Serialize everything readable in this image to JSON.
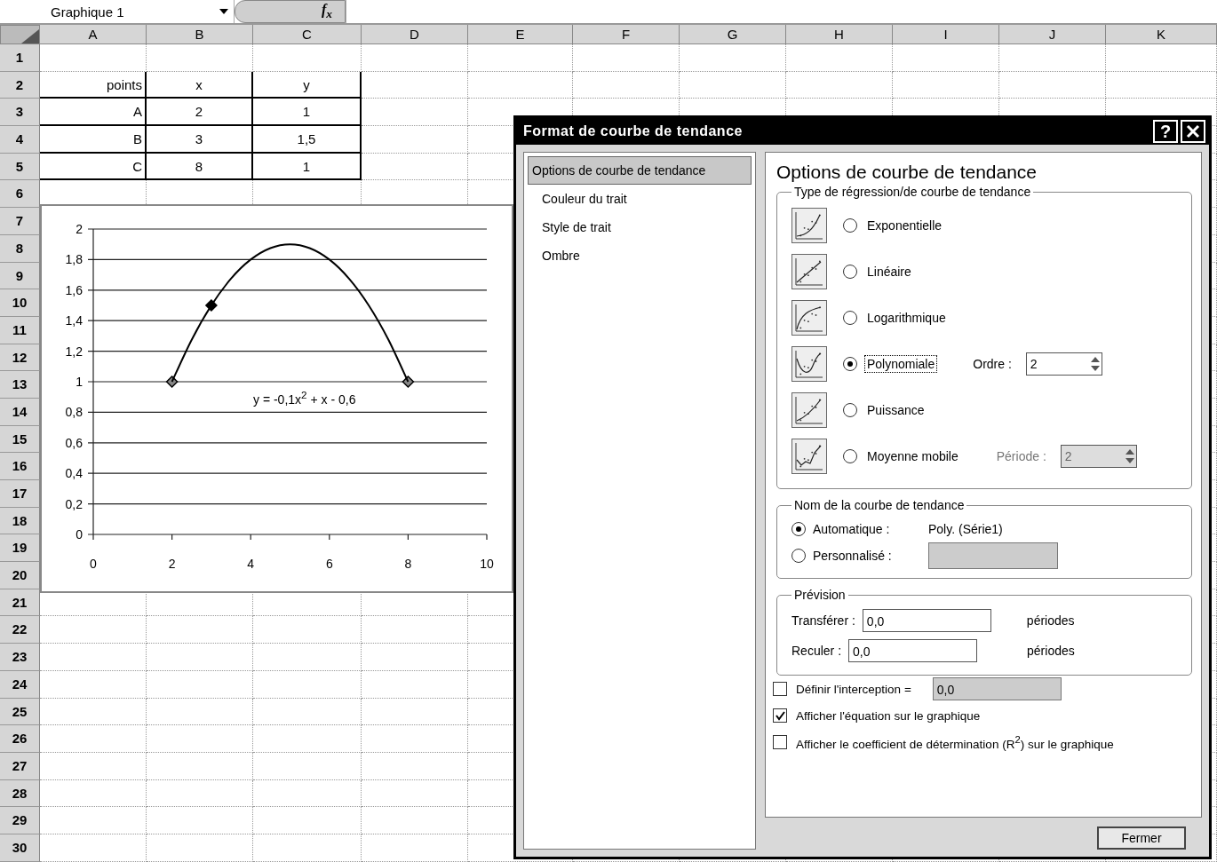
{
  "formula_bar": {
    "name_box": "Graphique 1",
    "function_button": "f$_{x}$"
  },
  "sheet": {
    "columns": [
      "A",
      "B",
      "C",
      "D",
      "E",
      "F",
      "G",
      "H",
      "I",
      "J",
      "K"
    ],
    "rows": [
      "1",
      "2",
      "3",
      "4",
      "5",
      "6",
      "7",
      "8",
      "9",
      "10",
      "11",
      "12",
      "13",
      "14",
      "15",
      "16",
      "17",
      "18",
      "19",
      "20",
      "21",
      "22",
      "23",
      "24",
      "25",
      "26",
      "27",
      "28",
      "29",
      "30"
    ],
    "table": {
      "rows": [
        [
          "points",
          "x",
          "y"
        ],
        [
          "A",
          "2",
          "1"
        ],
        [
          "B",
          "3",
          "1,5"
        ],
        [
          "C",
          "8",
          "1"
        ]
      ]
    }
  },
  "chart": {
    "chart_data": {
      "type": "scatter",
      "xlim": [
        0,
        10
      ],
      "ylim": [
        0,
        2
      ],
      "xticks": [
        0,
        2,
        4,
        6,
        8,
        10
      ],
      "yticks": [
        {
          "value": 0,
          "label": "0"
        },
        {
          "value": 0.2,
          "label": "0,2"
        },
        {
          "value": 0.4,
          "label": "0,4"
        },
        {
          "value": 0.6,
          "label": "0,6"
        },
        {
          "value": 0.8,
          "label": "0,8"
        },
        {
          "value": 1,
          "label": "1"
        },
        {
          "value": 1.2,
          "label": "1,2"
        },
        {
          "value": 1.4,
          "label": "1,4"
        },
        {
          "value": 1.6,
          "label": "1,6"
        },
        {
          "value": 1.8,
          "label": "1,8"
        },
        {
          "value": 2,
          "label": "2"
        }
      ],
      "grid": true,
      "series": [
        {
          "type": "scatter",
          "color": "#000000",
          "x": [
            2,
            3,
            8
          ],
          "values": [
            1,
            1.5,
            1
          ]
        },
        {
          "type": "line",
          "color": "#000000",
          "x": [
            2,
            2.5,
            3,
            3.5,
            4,
            4.5,
            5,
            5.5,
            6,
            6.5,
            7,
            7.5,
            8
          ],
          "values": [
            1,
            1.275,
            1.5,
            1.675,
            1.8,
            1.875,
            1.9,
            1.875,
            1.8,
            1.675,
            1.5,
            1.275,
            1
          ]
        }
      ],
      "annotations": [
        "y = -0,1x$^{2}$ + x - 0,6"
      ]
    }
  },
  "dialog": {
    "title": "Format de courbe de tendance",
    "help": "?",
    "sidebar": [
      {
        "label": "Options de courbe de tendance",
        "selected": true
      },
      {
        "label": "Couleur du trait",
        "selected": false
      },
      {
        "label": "Style de trait",
        "selected": false
      },
      {
        "label": "Ombre",
        "selected": false
      }
    ],
    "heading": "Options de courbe de tendance",
    "type_group": {
      "legend": "Type de régression/de courbe de tendance",
      "options": [
        {
          "label": "Exponentielle",
          "kind": "exponential",
          "selected": false,
          "focused": false
        },
        {
          "label": "Linéaire",
          "kind": "linear",
          "selected": false,
          "focused": false
        },
        {
          "label": "Logarithmique",
          "kind": "logarithmic",
          "selected": false,
          "focused": false
        },
        {
          "label": "Polynomiale",
          "kind": "polynomial",
          "selected": true,
          "focused": true,
          "param": {
            "label": "Ordre :",
            "value": "2",
            "disabled": false
          }
        },
        {
          "label": "Puissance",
          "kind": "power",
          "selected": false,
          "focused": false
        },
        {
          "label": "Moyenne mobile",
          "kind": "moving_average",
          "selected": false,
          "focused": false,
          "param": {
            "label": "Période :",
            "value": "2",
            "disabled": true
          }
        }
      ]
    },
    "name_group": {
      "legend": "Nom de la courbe de tendance",
      "options": [
        {
          "label": "Automatique :",
          "selected": true,
          "value": "Poly. (Série1)"
        },
        {
          "label": "Personnalisé :",
          "selected": false,
          "field": {
            "disabled": true
          }
        }
      ]
    },
    "forecast_group": {
      "legend": "Prévision",
      "rows": [
        {
          "label": "Transférer :",
          "value": "0,0",
          "unit": "périodes"
        },
        {
          "label": "Reculer :",
          "value": "0,0",
          "unit": "périodes"
        }
      ]
    },
    "checkboxes": [
      {
        "label": "Définir l'interception =",
        "checked": false,
        "field": {
          "value": "0,0",
          "disabled": true
        }
      },
      {
        "label": "Afficher l'équation sur le graphique",
        "checked": true
      },
      {
        "label": "Afficher le coefficient de détermination (R$^{2}$) sur le graphique",
        "checked": false
      }
    ],
    "close_button": "Fermer"
  }
}
